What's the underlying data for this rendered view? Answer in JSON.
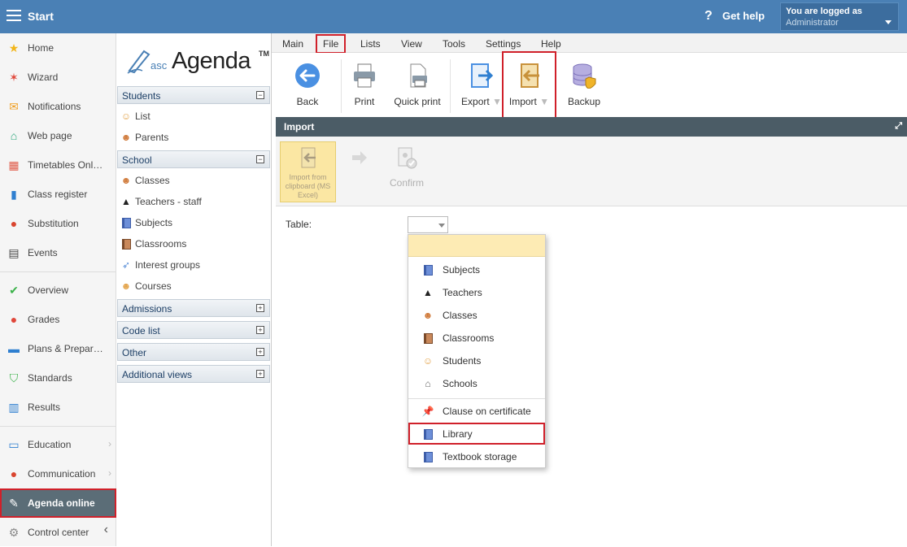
{
  "topbar": {
    "title": "Start",
    "help_label": "Get help",
    "help_icon": "?",
    "login_line1": "You are logged as",
    "login_user": "Administrator"
  },
  "leftnav": {
    "items": [
      {
        "label": "Home",
        "icon": "star-icon"
      },
      {
        "label": "Wizard",
        "icon": "wand-icon"
      },
      {
        "label": "Notifications",
        "icon": "envelope-icon"
      },
      {
        "label": "Web page",
        "icon": "house-icon"
      },
      {
        "label": "Timetables Onl…",
        "icon": "grid-calendar-icon"
      },
      {
        "label": "Class register",
        "icon": "book-icon"
      },
      {
        "label": "Substitution",
        "icon": "person-icon"
      },
      {
        "label": "Events",
        "icon": "calendar-icon"
      },
      {
        "label": "Overview",
        "icon": "check-circle-icon"
      },
      {
        "label": "Grades",
        "icon": "grades-icon"
      },
      {
        "label": "Plans & Prepar…",
        "icon": "plans-icon"
      },
      {
        "label": "Standards",
        "icon": "shield-check-icon"
      },
      {
        "label": "Results",
        "icon": "bar-chart-icon"
      },
      {
        "label": "Education",
        "icon": "open-book-icon"
      },
      {
        "label": "Communication",
        "icon": "chat-icon"
      },
      {
        "label": "Agenda online",
        "icon": "pen-icon"
      },
      {
        "label": "Control center",
        "icon": "gear-icon"
      }
    ]
  },
  "sidebar": {
    "logo_asc": "asc",
    "logo_name": "Agenda",
    "logo_tm": "TM",
    "sections": [
      {
        "label": "Students",
        "toggle": "−"
      },
      {
        "label": "School",
        "toggle": "−"
      },
      {
        "label": "Admissions",
        "toggle": "+"
      },
      {
        "label": "Code list",
        "toggle": "+"
      },
      {
        "label": "Other",
        "toggle": "+"
      },
      {
        "label": "Additional views",
        "toggle": "+"
      }
    ],
    "students_items": [
      "List",
      "Parents"
    ],
    "school_items": [
      "Classes",
      "Teachers - staff",
      "Subjects",
      "Classrooms",
      "Interest groups",
      "Courses"
    ]
  },
  "menubar": {
    "items": [
      "Main",
      "File",
      "Lists",
      "View",
      "Tools",
      "Settings",
      "Help"
    ]
  },
  "toolbar": {
    "back": "Back",
    "print": "Print",
    "quick_print": "Quick print",
    "export": "Export",
    "import": "Import",
    "backup": "Backup"
  },
  "panel": {
    "title": "Import",
    "expand_icon": "⤢",
    "import_clipboard": "Import from clipboard (MS Excel)",
    "confirm": "Confirm",
    "table_label": "Table:"
  },
  "dropdown": {
    "items": [
      "Subjects",
      "Teachers",
      "Classes",
      "Classrooms",
      "Students",
      "Schools",
      "Clause on certificate",
      "Library",
      "Textbook storage"
    ]
  },
  "colors": {
    "topbar": "#4a80b5",
    "panel_header": "#4b5c66",
    "highlight": "#d0202a",
    "dropdown_selected": "#fdebb4"
  }
}
